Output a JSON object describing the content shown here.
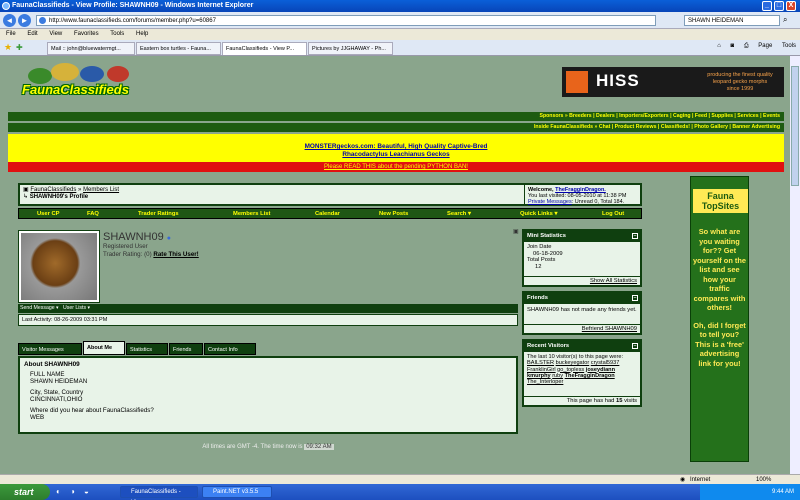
{
  "window": {
    "title": "FaunaClassifieds - View Profile: SHAWNH09 - Windows Internet Explorer",
    "min": "_",
    "max": "□",
    "close": "X"
  },
  "address": {
    "url": "http://www.faunaclassifieds.com/forums/member.php?u=60867",
    "search": "SHAWN HEIDEMAN"
  },
  "menu": [
    "File",
    "Edit",
    "View",
    "Favorites",
    "Tools",
    "Help"
  ],
  "tabs": [
    {
      "label": "Mail :: john@bluewatermgt..."
    },
    {
      "label": "Eastern box turtles - Fauna..."
    },
    {
      "label": "FaunaClassifieds - View P..."
    },
    {
      "label": "Pictures by JJGHAWAY - Ph..."
    }
  ],
  "toolbar_right": {
    "page": "Page",
    "tools": "Tools"
  },
  "site": {
    "logo_text": "FaunaClassifieds",
    "hiss": {
      "name": "HISS",
      "slogan": "producing the finest quality leopard gecko morphs",
      "since": "since 1999"
    },
    "toplinks": "Sponsors » Breeders | Dealers | Importers/Exporters | Caging | Feed | Supplies | Services | Events",
    "inlinks": "Inside FaunaClassifieds » Chat | Product Reviews | Classifieds! | Photo Gallery | Banner Advertising",
    "ad_line1": "MONSTERgeckos.com: Beautiful, High Quality Captive-Bred",
    "ad_line2": "Rhacodactylus Leachianus Geckos",
    "red_notice": "Please READ THIS about the pending PYTHON BAN!"
  },
  "breadcrumb": {
    "root": "FaunaClassifieds",
    "sep": "»",
    "members": "Members List",
    "current": "SHAWNH09's Profile"
  },
  "welcome": {
    "prefix": "Welcome,",
    "user": "TheFragginDragon.",
    "last_visited": "You last visited: 08-05-2010 at 11:38 PM",
    "pm_label": "Private Messages",
    "pm_rest": ": Unread 0, Total 184."
  },
  "navbar": [
    "User CP",
    "FAQ",
    "Trader Ratings",
    "Members List",
    "Calendar",
    "New Posts",
    "Search ▾",
    "Quick Links ▾",
    "Log Out"
  ],
  "profile": {
    "username": "SHAWNH09",
    "role": "Registered User",
    "trader_label": "Trader Rating:",
    "trader_value": "(0)",
    "rate_link": "Rate This User!",
    "send_message": "Send Message ▾",
    "user_lists": "User Lists ▾",
    "last_activity": "Last Activity: 08-26-2009 03:31 PM"
  },
  "profile_tabs": [
    "Visitor Messages",
    "About Me",
    "Statistics",
    "Friends",
    "Contact Info"
  ],
  "about": {
    "heading": "About SHAWNH09",
    "full_name_label": "FULL NAME",
    "full_name": "SHAWN HEIDEMAN",
    "location_label": "City, State, Country",
    "location": "CINCINNATI,OHIO",
    "heard_label": "Where did you hear about FaunaClassifieds?",
    "heard": "WEB"
  },
  "timeline": {
    "text": "All times are GMT -4. The time now is",
    "time": "09:32 AM"
  },
  "mini_stats": {
    "title": "Mini Statistics",
    "join_label": "Join Date",
    "join_date": "06-18-2009",
    "posts_label": "Total Posts",
    "posts": "12",
    "footer": "Show All Statistics"
  },
  "friends": {
    "title": "Friends",
    "text": "SHAWNH09 has not made any friends yet.",
    "footer": "Befriend SHAWNH09"
  },
  "visitors": {
    "title": "Recent Visitors",
    "intro": "The last 10 visitor(s) to this page were:",
    "names": [
      "BAILSTER",
      "buckeyegator",
      "crystal5937",
      "FranklinGirl",
      "go_topless",
      "joseydiann",
      "kmurphy",
      "ruby",
      "TheFragginDragon",
      "The_Interloper"
    ],
    "footer_pre": "This page has had",
    "footer_count": "15",
    "footer_post": "visits"
  },
  "topsites": {
    "title1": "Fauna",
    "title2": "TopSites",
    "pitch1": "So what are you waiting for?? Get yourself on the list and see how your traffic compares with others!",
    "pitch2": "Oh, did I forget to tell you? This is a 'free' advertising link for you!"
  },
  "statusbar": {
    "zone": "Internet",
    "zoom": "100%"
  },
  "taskbar": {
    "start": "start",
    "tasks": [
      "FaunaClassifieds - View...",
      "Paint.NET v3.5.5"
    ],
    "clock": "9:44 AM"
  },
  "colors": {
    "forest": "#0f3f0f",
    "page_bg": "#8aa58c",
    "link_yellow": "#ffff00",
    "ad_yellow": "#ffff00",
    "notice_red": "#e01010"
  }
}
